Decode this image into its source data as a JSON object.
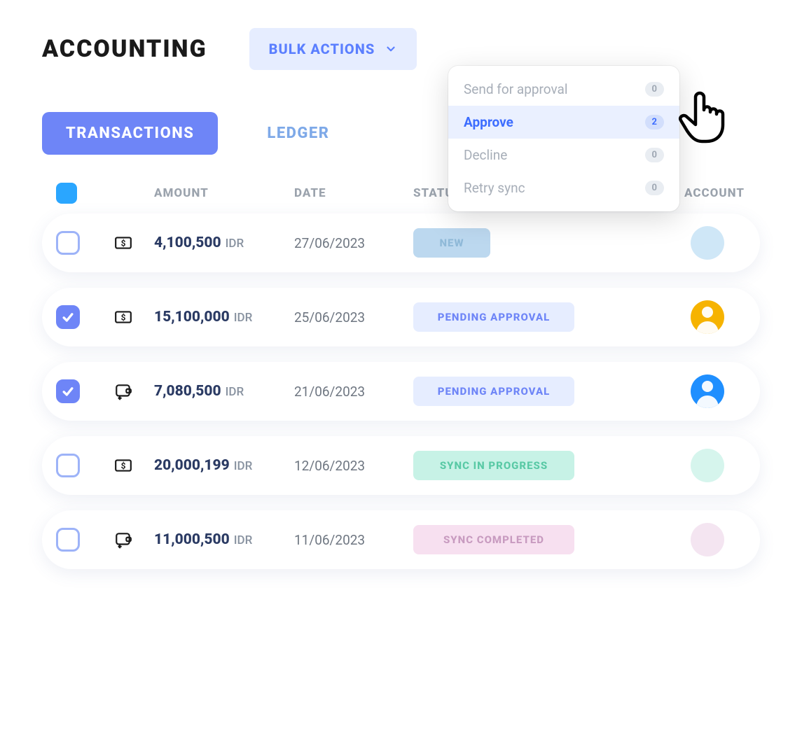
{
  "title": "ACCOUNTING",
  "bulk_actions": {
    "label": "BULK ACTIONS",
    "items": [
      {
        "label": "Send for approval",
        "count": "0",
        "active": false
      },
      {
        "label": "Approve",
        "count": "2",
        "active": true
      },
      {
        "label": "Decline",
        "count": "0",
        "active": false
      },
      {
        "label": "Retry sync",
        "count": "0",
        "active": false
      }
    ]
  },
  "tabs": {
    "transactions": "TRANSACTIONS",
    "ledger": "LEDGER"
  },
  "columns": {
    "amount": "AMOUNT",
    "date": "DATE",
    "status": "STATUS",
    "account": "ACCOUNT"
  },
  "rows": [
    {
      "checked": false,
      "type": "cash",
      "amount": "4,100,500",
      "currency": "IDR",
      "date": "27/06/2023",
      "status_label": "NEW",
      "status_kind": "new",
      "avatar": "blank-blue"
    },
    {
      "checked": true,
      "type": "cash",
      "amount": "15,100,000",
      "currency": "IDR",
      "date": "25/06/2023",
      "status_label": "PENDING APPROVAL",
      "status_kind": "pending",
      "avatar": "person1"
    },
    {
      "checked": true,
      "type": "wallet",
      "amount": "7,080,500",
      "currency": "IDR",
      "date": "21/06/2023",
      "status_label": "PENDING APPROVAL",
      "status_kind": "pending",
      "avatar": "person2"
    },
    {
      "checked": false,
      "type": "cash",
      "amount": "20,000,199",
      "currency": "IDR",
      "date": "12/06/2023",
      "status_label": "SYNC IN PROGRESS",
      "status_kind": "sync",
      "avatar": "blank-teal"
    },
    {
      "checked": false,
      "type": "wallet",
      "amount": "11,000,500",
      "currency": "IDR",
      "date": "11/06/2023",
      "status_label": "SYNC COMPLETED",
      "status_kind": "done",
      "avatar": "blank-pink"
    }
  ]
}
